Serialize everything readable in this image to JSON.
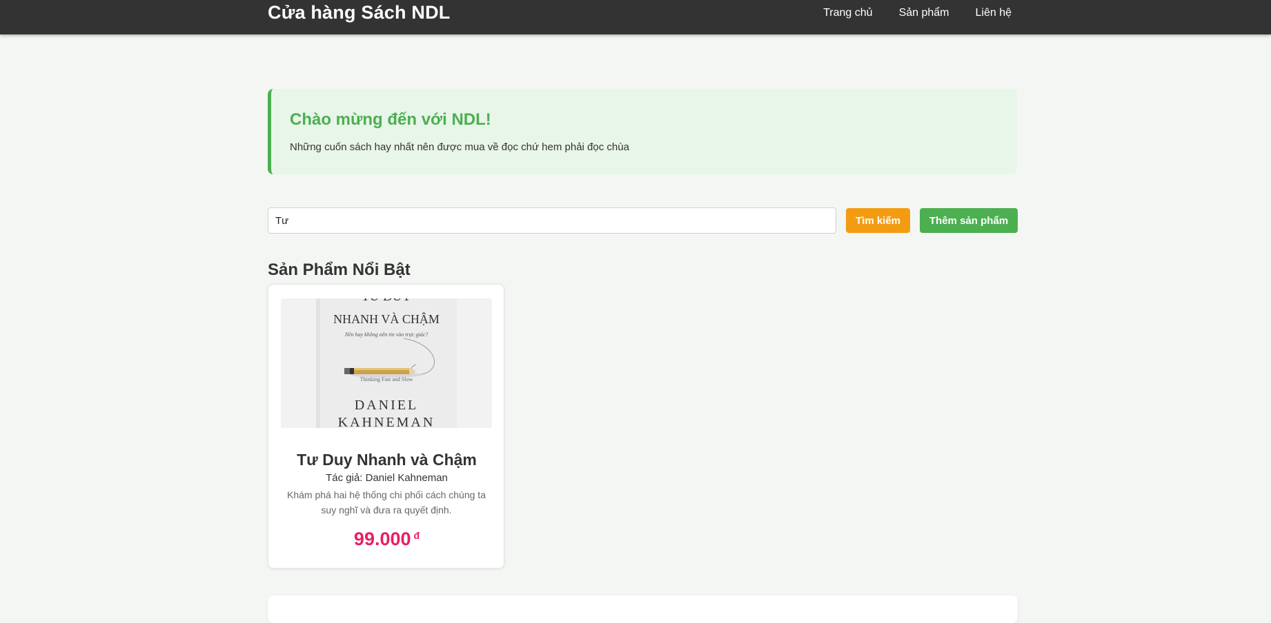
{
  "header": {
    "brand": "Cửa hàng Sách NDL",
    "nav": [
      "Trang chủ",
      "Sản phẩm",
      "Liên hệ"
    ]
  },
  "welcome": {
    "title": "Chào mừng đến với NDL!",
    "text": "Những cuốn sách hay nhất nên được mua về đọc chứ hem phải đọc chùa"
  },
  "search": {
    "value": "Tư",
    "search_button": "Tìm kiếm",
    "add_button": "Thêm sản phẩm"
  },
  "section": {
    "title": "Sản Phẩm Nổi Bật"
  },
  "products": [
    {
      "cover": {
        "top_text": "TƯ DUY",
        "title_text": "NHANH VÀ CHẬM",
        "subtitle": "Nên hay không nên tin vào trực giác?",
        "english": "Thinking Fast and Slow",
        "author_line1": "DANIEL",
        "author_line2": "KAHNEMAN"
      },
      "title": "Tư Duy Nhanh và Chậm",
      "author": "Tác giả: Daniel Kahneman",
      "description": "Khám phá hai hệ thống chi phối cách chúng ta suy nghĩ và đưa ra quyết định.",
      "price": "99.000",
      "currency": "đ"
    }
  ],
  "colors": {
    "header_bg": "#333333",
    "accent_green": "#4caf50",
    "search_orange": "#f39c12",
    "price_pink": "#e91e63"
  }
}
